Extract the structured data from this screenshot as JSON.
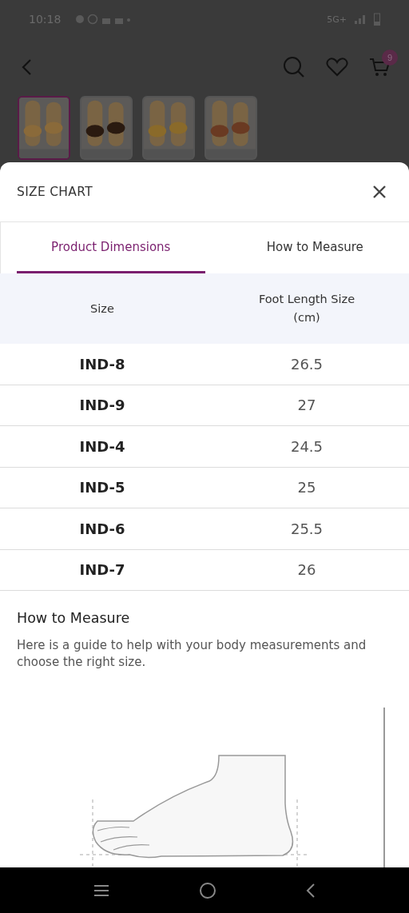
{
  "status_bar": {
    "time": "10:18",
    "network": "5G+"
  },
  "top_bar": {
    "cart_count": "9"
  },
  "thumbnails": [
    {
      "selected": true
    },
    {
      "selected": false
    },
    {
      "selected": false
    },
    {
      "selected": false
    }
  ],
  "sheet": {
    "title": "SIZE CHART",
    "tabs": [
      {
        "label": "Product Dimensions",
        "selected": true
      },
      {
        "label": "How to Measure",
        "selected": false
      }
    ],
    "table": {
      "columns": [
        "Size",
        "Foot Length Size\n(cm)"
      ],
      "rows": [
        [
          "IND-8",
          "26.5"
        ],
        [
          "IND-9",
          "27"
        ],
        [
          "IND-4",
          "24.5"
        ],
        [
          "IND-5",
          "25"
        ],
        [
          "IND-6",
          "25.5"
        ],
        [
          "IND-7",
          "26"
        ]
      ]
    },
    "guide": {
      "heading": "How to Measure",
      "text": "Here is a guide to help with your body measurements and choose the right size."
    }
  }
}
